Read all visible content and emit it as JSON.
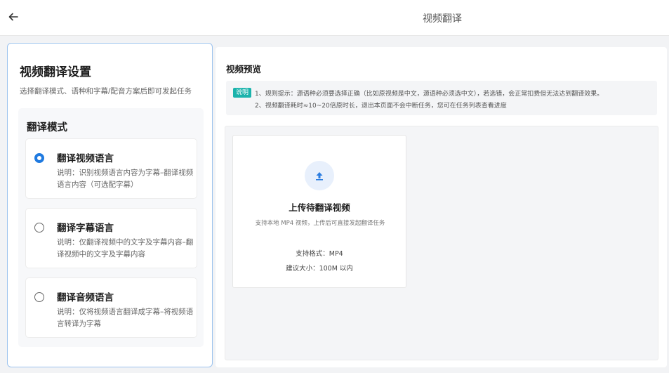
{
  "header": {
    "title": "视频翻译"
  },
  "settings": {
    "title": "视频翻译设置",
    "description": "选择翻译模式、语种和字幕/配音方案后即可发起任务",
    "mode_section_title": "翻译模式",
    "options": [
      {
        "title": "翻译视频语言",
        "description": "说明：识别视频语言内容为字幕–翻译视频语言内容（可选配字幕）",
        "selected": true
      },
      {
        "title": "翻译字幕语言",
        "description": "说明：仅翻译视频中的文字及字幕内容–翻译视频中的文字及字幕内容",
        "selected": false
      },
      {
        "title": "翻译音频语言",
        "description": "说明：仅将视频语言翻译成字幕–将视频语言转译为字幕",
        "selected": false
      }
    ]
  },
  "preview": {
    "title": "视频预览",
    "notice_badge": "说明",
    "notice_lines": [
      "1、规则提示：源语种必须要选择正确（比如原视频是中文，源语种必须选中文），若选错，会正常扣费但无法达到翻译效果。",
      "2、视频翻译耗时≈10~20倍原时长，退出本页面不会中断任务，您可在任务列表查看进度"
    ],
    "upload": {
      "title": "上传待翻译视频",
      "description": "支持本地 MP4 视频，上传后可直接发起翻译任务",
      "format": "支持格式：MP4",
      "size": "建议大小：100M 以内"
    }
  },
  "colors": {
    "accent": "#1f7ae0",
    "badge": "#1bb3ac",
    "panel_border": "#9cc3ee"
  },
  "icons": {
    "back": "arrow-left-icon",
    "upload": "upload-arrow-icon"
  }
}
